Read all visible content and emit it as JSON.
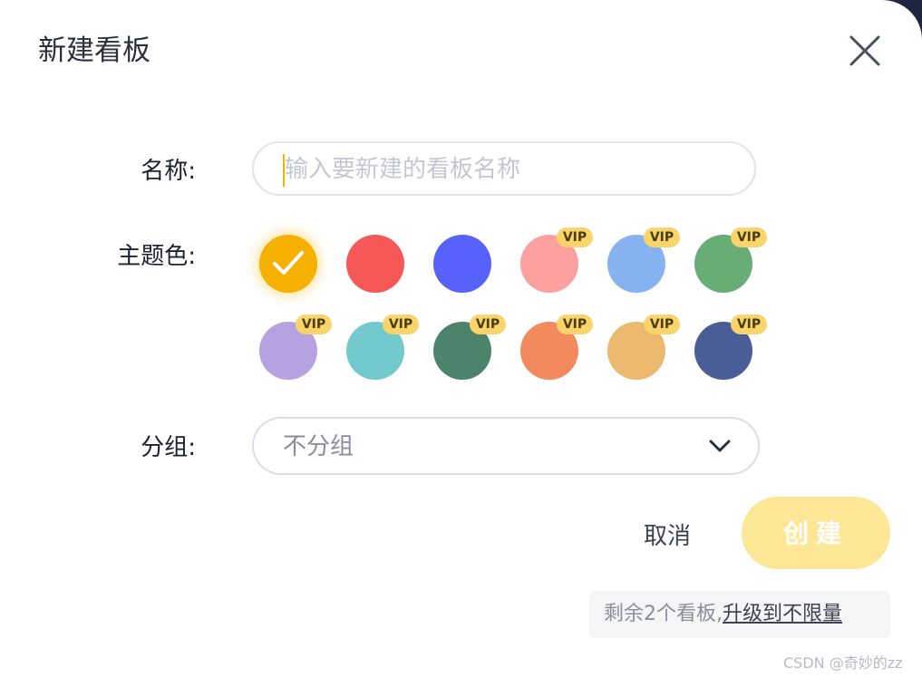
{
  "dialog": {
    "title": "新建看板",
    "close_icon": "close-icon"
  },
  "form": {
    "name_label": "名称:",
    "name_placeholder": "输入要新建的看板名称",
    "name_value": "",
    "color_label": "主题色:",
    "group_label": "分组:",
    "group_value": "不分组"
  },
  "colors": [
    {
      "hex": "#f5b000",
      "vip": false,
      "selected": true
    },
    {
      "hex": "#f65757",
      "vip": false,
      "selected": false
    },
    {
      "hex": "#5762fb",
      "vip": false,
      "selected": false
    },
    {
      "hex": "#fda0a0",
      "vip": true,
      "selected": false
    },
    {
      "hex": "#86b2ef",
      "vip": true,
      "selected": false
    },
    {
      "hex": "#68ad75",
      "vip": true,
      "selected": false
    },
    {
      "hex": "#b6a1e1",
      "vip": true,
      "selected": false
    },
    {
      "hex": "#72c9cb",
      "vip": true,
      "selected": false
    },
    {
      "hex": "#4b836b",
      "vip": true,
      "selected": false
    },
    {
      "hex": "#f28a5e",
      "vip": true,
      "selected": false
    },
    {
      "hex": "#ebb96d",
      "vip": true,
      "selected": false
    },
    {
      "hex": "#495e96",
      "vip": true,
      "selected": false
    }
  ],
  "vip_badge": "VIP",
  "actions": {
    "cancel_label": "取消",
    "create_label": "创建"
  },
  "quota": {
    "text": "剩余2个看板,",
    "upgrade_link": "升级到不限量"
  },
  "watermark": "CSDN @奇妙的zz"
}
